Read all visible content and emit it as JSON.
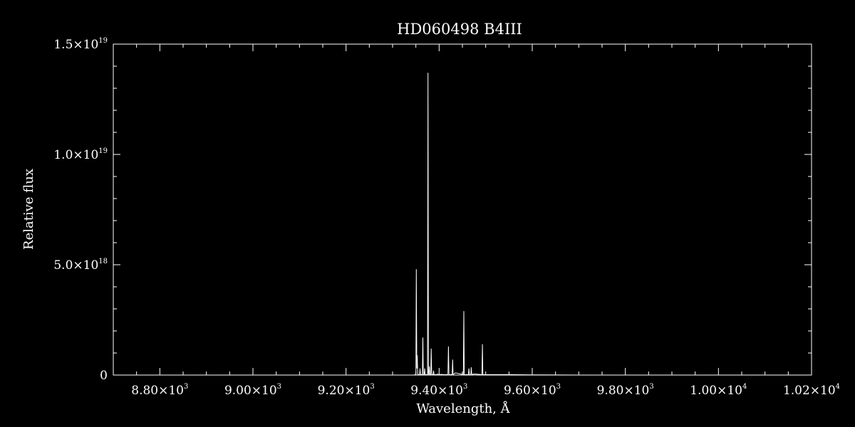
{
  "chart_data": {
    "type": "line",
    "title": "HD060498   B4III",
    "xlabel": "Wavelength, Å",
    "ylabel": "Relative flux",
    "xlim": [
      8700,
      10200
    ],
    "ylim": [
      0,
      1.5e+19
    ],
    "grid": false,
    "colors": {
      "background": "#000000",
      "foreground": "#ffffff"
    },
    "x_ticks": [
      {
        "value": 8800,
        "mantissa": "8.80×10",
        "exponent": "3"
      },
      {
        "value": 9000,
        "mantissa": "9.00×10",
        "exponent": "3"
      },
      {
        "value": 9200,
        "mantissa": "9.20×10",
        "exponent": "3"
      },
      {
        "value": 9400,
        "mantissa": "9.40×10",
        "exponent": "3"
      },
      {
        "value": 9600,
        "mantissa": "9.60×10",
        "exponent": "3"
      },
      {
        "value": 9800,
        "mantissa": "9.80×10",
        "exponent": "3"
      },
      {
        "value": 10000,
        "mantissa": "1.00×10",
        "exponent": "4"
      },
      {
        "value": 10200,
        "mantissa": "1.02×10",
        "exponent": "4"
      }
    ],
    "y_ticks": [
      {
        "value": 0,
        "mantissa": "0",
        "exponent": ""
      },
      {
        "value": 5e+18,
        "mantissa": "5.0×10",
        "exponent": "18"
      },
      {
        "value": 1e+19,
        "mantissa": "1.0×10",
        "exponent": "19"
      },
      {
        "value": 1.5e+19,
        "mantissa": "1.5×10",
        "exponent": "19"
      }
    ],
    "series": [
      {
        "x": [
          8700,
          8800,
          8900,
          9000,
          9100,
          9200,
          9300,
          9330,
          9345,
          9350,
          9351,
          9352,
          9353,
          9354,
          9358,
          9359,
          9360,
          9364,
          9365,
          9366,
          9368,
          9369,
          9370,
          9375,
          9376,
          9377,
          9378,
          9379,
          9380,
          9382,
          9383,
          9384,
          9387,
          9388,
          9389,
          9396,
          9397,
          9398,
          9400,
          9405,
          9410,
          9419,
          9420,
          9421,
          9428,
          9429,
          9430,
          9435,
          9452,
          9453,
          9454,
          9463,
          9464,
          9465,
          9468,
          9469,
          9470,
          9475,
          9492,
          9493,
          9494,
          9500,
          9550,
          9600,
          9700,
          9800,
          9900,
          10000,
          10100,
          10200
        ],
        "y": [
          0,
          0,
          0,
          0,
          0,
          0,
          0,
          0,
          0,
          2e+16,
          4.8e+18,
          3e+17,
          9e+17,
          2e+16,
          2e+16,
          3e+17,
          2e+16,
          2e+16,
          1.7e+18,
          2e+16,
          2e+16,
          3e+17,
          2e+16,
          2e+16,
          1.37e+19,
          2e+16,
          2e+16,
          4e+17,
          2e+16,
          2e+16,
          1.2e+18,
          2e+16,
          2e+16,
          2e+17,
          2e+16,
          2e+16,
          5e+16,
          2e+16,
          2e+16,
          3e+16,
          2e+16,
          2e+16,
          1.3e+18,
          2e+16,
          2e+16,
          7e+17,
          2e+16,
          1e+17,
          2e+16,
          2.9e+18,
          2e+16,
          2e+16,
          3e+17,
          2e+16,
          2e+16,
          3.5e+17,
          2e+16,
          5e+16,
          2e+16,
          1.4e+18,
          2e+16,
          2e+16,
          2e+16,
          1e+16,
          0,
          0,
          0,
          0,
          0,
          0
        ]
      }
    ]
  }
}
